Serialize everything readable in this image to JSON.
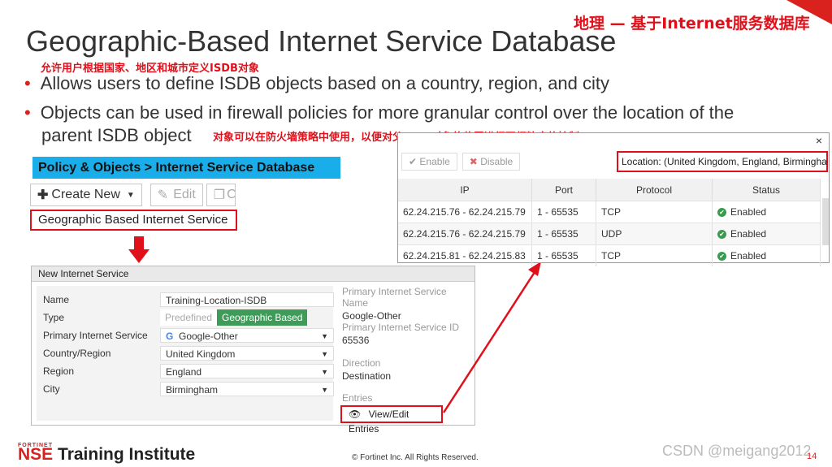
{
  "slide": {
    "title": "Geographic-Based Internet Service Database",
    "title_zh": "地理 — 基于Internet服务数据库",
    "bullet1_zh": "允许用户根据国家、地区和城市定义ISDB对象",
    "bullet1": "Allows users to define ISDB objects based on a country, region, and city",
    "bullet2_line1": "Objects can be used in firewall policies for more granular control over the location of the",
    "bullet2_line2": "parent ISDB object",
    "bullet2_zh": "对象可以在防火墙策略中使用，以便对父ISDB对象的位置进行更细粒度的控制",
    "bullet_mark": "•"
  },
  "breadcrumb": "Policy & Objects > Internet Service Database",
  "toolbar": {
    "create_new": "Create New",
    "create_new_icon": "plus-icon",
    "edit": "Edit",
    "edit_icon": "pencil-icon",
    "clone_partial": "C"
  },
  "menu_item": "Geographic Based Internet Service",
  "form": {
    "header": "New Internet Service",
    "name_label": "Name",
    "name_value": "Training-Location-ISDB",
    "type_label": "Type",
    "type_options": [
      "Predefined",
      "Geographic Based"
    ],
    "primary_label": "Primary Internet Service",
    "primary_value": "Google-Other",
    "country_label": "Country/Region",
    "country_value": "United Kingdom",
    "region_label": "Region",
    "region_value": "England",
    "city_label": "City",
    "city_value": "Birmingham"
  },
  "side": {
    "psn_label": "Primary Internet Service Name",
    "psn_value": "Google-Other",
    "psid_label": "Primary Internet Service ID",
    "psid_value": "65536",
    "dir_label": "Direction",
    "dir_value": "Destination",
    "entries_label": "Entries",
    "entries_button": "View/Edit Entries"
  },
  "dialog": {
    "close": "×",
    "enable": "Enable",
    "disable": "Disable",
    "location": "Location: (United Kingdom, England, Birmingham)",
    "columns": [
      "IP",
      "Port",
      "Protocol",
      "Status"
    ],
    "rows": [
      {
        "ip": "62.24.215.76 - 62.24.215.79",
        "port": "1 - 65535",
        "protocol": "TCP",
        "status": "Enabled"
      },
      {
        "ip": "62.24.215.76 - 62.24.215.79",
        "port": "1 - 65535",
        "protocol": "UDP",
        "status": "Enabled"
      },
      {
        "ip": "62.24.215.81 - 62.24.215.83",
        "port": "1 - 65535",
        "protocol": "TCP",
        "status": "Enabled"
      }
    ]
  },
  "footer": {
    "brand_small": "FORTINET",
    "brand_nse": "NSE",
    "brand_rest": " Training Institute",
    "copyright": "© Fortinet Inc. All Rights Reserved.",
    "watermark": "CSDN @meigang2012",
    "page": "14"
  },
  "colors": {
    "accent_red": "#d9211d",
    "breadcrumb_blue": "#19aee9",
    "geo_green": "#3f9b58"
  }
}
